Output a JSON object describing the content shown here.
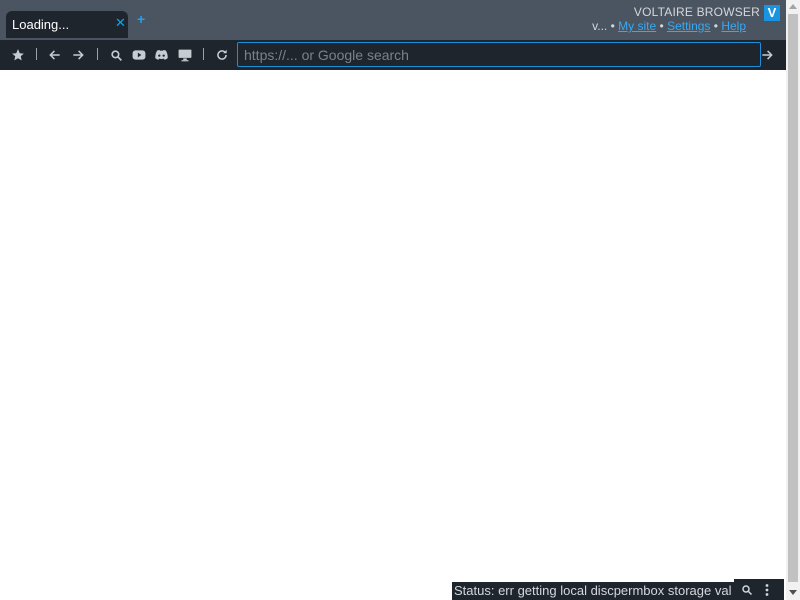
{
  "tab": {
    "title": "Loading...",
    "close_glyph": "✕"
  },
  "new_tab_glyph": "+",
  "brand": {
    "name": "VOLTAIRE BROWSER",
    "logo_letter": "V",
    "accent": "#1894e3"
  },
  "user_links": {
    "prefix": "v...",
    "separator": "•",
    "links": [
      "My site",
      "Settings",
      "Help"
    ]
  },
  "toolbar": {
    "items": [
      {
        "id": "bookmark",
        "icon": "star-icon"
      },
      {
        "id": "back",
        "icon": "arrow-left-icon"
      },
      {
        "id": "forward",
        "icon": "arrow-right-icon"
      },
      {
        "id": "search",
        "icon": "search-icon"
      },
      {
        "id": "youtube",
        "icon": "youtube-icon"
      },
      {
        "id": "discord",
        "icon": "discord-icon"
      },
      {
        "id": "desktop",
        "icon": "monitor-icon"
      },
      {
        "id": "reload",
        "icon": "reload-icon"
      },
      {
        "id": "go",
        "icon": "arrow-right-icon"
      }
    ]
  },
  "url_bar": {
    "value": "",
    "placeholder": "https://... or Google search"
  },
  "status_bar": {
    "text": "Status: err getting local discpermbox storage val",
    "tools": [
      "search-icon",
      "more-vertical-icon"
    ]
  },
  "colors": {
    "bar_bg": "#4b5562",
    "dark_bg": "#1f252d",
    "link": "#36a9f2"
  }
}
